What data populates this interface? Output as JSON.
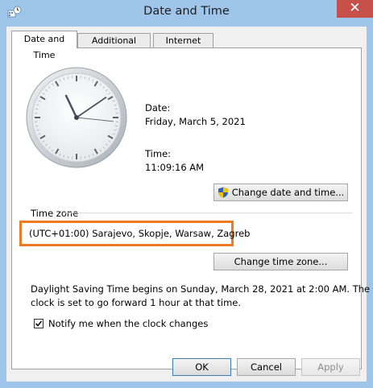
{
  "window": {
    "title": "Date and Time",
    "close_label": "✕"
  },
  "tabs": [
    {
      "label": "Date and Time",
      "selected": true
    },
    {
      "label": "Additional Clocks",
      "selected": false
    },
    {
      "label": "Internet Time",
      "selected": false
    }
  ],
  "clock": {
    "hour": 11,
    "minute": 9,
    "second": 16
  },
  "date_time": {
    "date_label": "Date:",
    "date_value": "Friday, March 5, 2021",
    "time_label": "Time:",
    "time_value": "11:09:16 AM",
    "change_button": "Change date and time..."
  },
  "time_zone": {
    "group_label": "Time zone",
    "value": "(UTC+01:00) Sarajevo, Skopje, Warsaw, Zagreb",
    "change_button": "Change time zone..."
  },
  "dst": {
    "line1": "Daylight Saving Time begins on Sunday, March 28, 2021 at 2:00 AM. The",
    "line2": "clock is set to go forward 1 hour at that time."
  },
  "notify": {
    "label": "Notify me when the clock changes",
    "checked": true
  },
  "footer": {
    "ok": "OK",
    "cancel": "Cancel",
    "apply": "Apply"
  },
  "icons": {
    "app": "date-time-control-panel-icon",
    "shield": "uac-shield-icon",
    "check": "checkmark-icon"
  },
  "colors": {
    "titlebar": "#9fc5ea",
    "close": "#c7504a",
    "highlight": "#ee7a23",
    "dialog": "#f0f0f0"
  }
}
